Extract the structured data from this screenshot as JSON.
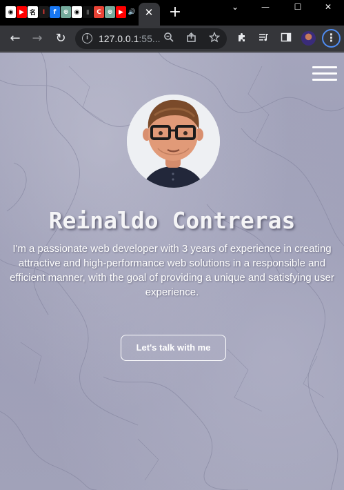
{
  "browser": {
    "tab_favicons": [
      {
        "icon": "github-icon",
        "glyph": "◉",
        "bg": "#ffffff",
        "fg": "#000000"
      },
      {
        "icon": "youtube-icon",
        "glyph": "▶",
        "bg": "#ff0000",
        "fg": "#ffffff"
      },
      {
        "icon": "name-icon",
        "glyph": "名",
        "bg": "#ffffff",
        "fg": "#000000"
      },
      {
        "icon": "bookmark-icon",
        "glyph": "I",
        "bg": "#1a1a1a",
        "fg": "#e53935"
      },
      {
        "icon": "facebook-icon",
        "glyph": "f",
        "bg": "#1877f2",
        "fg": "#ffffff"
      },
      {
        "icon": "chatgpt-icon",
        "glyph": "⊛",
        "bg": "#74aa9c",
        "fg": "#ffffff"
      },
      {
        "icon": "github-icon",
        "glyph": "◉",
        "bg": "#ffffff",
        "fg": "#000000"
      },
      {
        "icon": "dark-app-icon",
        "glyph": "▮",
        "bg": "#111111",
        "fg": "#555555"
      },
      {
        "icon": "chrome-c-icon",
        "glyph": "C",
        "bg": "#ea4335",
        "fg": "#ffffff"
      },
      {
        "icon": "chatgpt-icon",
        "glyph": "⊛",
        "bg": "#74aa9c",
        "fg": "#ffffff"
      },
      {
        "icon": "youtube-icon",
        "glyph": "▶",
        "bg": "#ff0000",
        "fg": "#ffffff"
      },
      {
        "icon": "speaker-icon",
        "glyph": "🔊",
        "bg": "#000000",
        "fg": "#ffffff"
      }
    ],
    "tab_close": "✕",
    "new_tab": "+",
    "window_controls": {
      "collapse": "⌄",
      "minimize": "—",
      "maximize": "☐",
      "close": "✕"
    },
    "toolbar": {
      "back": "←",
      "forward": "→",
      "reload": "↻",
      "url_host": "127.0.0.1",
      "url_rest": ":55...",
      "info": "i"
    }
  },
  "page": {
    "name": "Reinaldo Contreras",
    "bio": "I'm a passionate web developer with 3 years of experience in creating attractive and high-performance web solutions in a responsible and efficient manner, with the goal of providing a unique and satisfying user experience.",
    "cta_label": "Let's talk with me"
  },
  "colors": {
    "tabstrip": "#000000",
    "toolbar": "#35363a",
    "omnibox": "#202124",
    "accent_ring": "#4f8df5",
    "page_bg": "#a0a1b8",
    "text": "#ffffff"
  }
}
